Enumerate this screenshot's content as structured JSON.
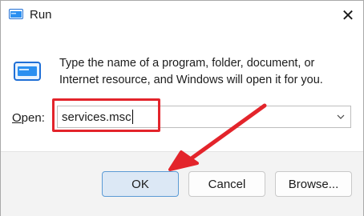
{
  "window": {
    "title": "Run",
    "close_glyph": "✕"
  },
  "dialog": {
    "description": "Type the name of a program, folder, document, or Internet resource, and Windows will open it for you.",
    "open_label_accel": "O",
    "open_label_rest": "pen:",
    "input_value": "services.msc"
  },
  "buttons": {
    "ok": "OK",
    "cancel": "Cancel",
    "browse": "Browse..."
  },
  "icons": {
    "title": "run-icon",
    "main": "run-icon",
    "dropdown": "chevron-down-icon",
    "close": "close-icon"
  },
  "colors": {
    "highlight": "#e3242b",
    "arrow": "#e3242b",
    "ok_fill": "#dce8f5",
    "ok_border": "#5b9bd5"
  }
}
